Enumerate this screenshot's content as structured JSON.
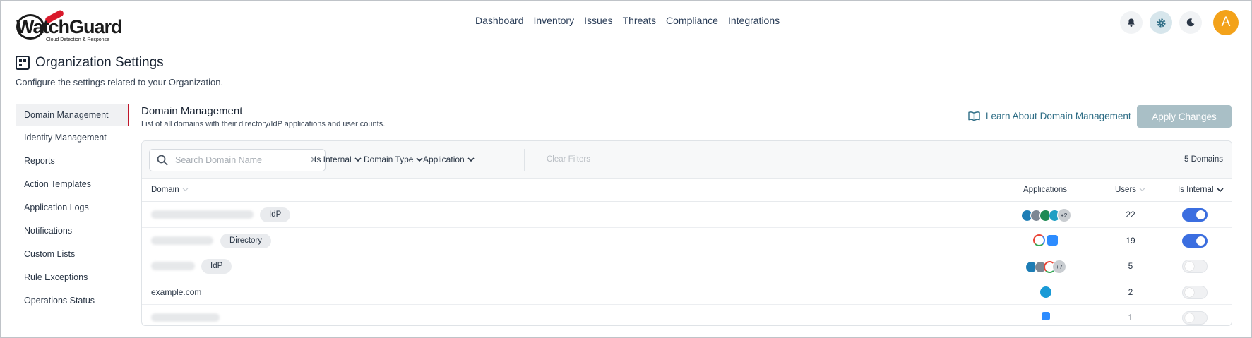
{
  "brand": {
    "name": "WatchGuard",
    "tagline": "Cloud Detection & Response",
    "accent": "#d9192b"
  },
  "nav": {
    "items": [
      "Dashboard",
      "Inventory",
      "Issues",
      "Threats",
      "Compliance",
      "Integrations"
    ]
  },
  "header": {
    "avatar_letter": "A",
    "icons": [
      "bell-icon",
      "gear-icon",
      "moon-icon"
    ]
  },
  "page": {
    "title": "Organization Settings",
    "subtitle": "Configure the settings related to your Organization."
  },
  "sidebar": {
    "items": [
      {
        "label": "Domain Management",
        "active": true
      },
      {
        "label": "Identity Management"
      },
      {
        "label": "Reports"
      },
      {
        "label": "Action Templates"
      },
      {
        "label": "Application Logs"
      },
      {
        "label": "Notifications"
      },
      {
        "label": "Custom Lists"
      },
      {
        "label": "Rule Exceptions"
      },
      {
        "label": "Operations Status"
      }
    ]
  },
  "main": {
    "title": "Domain Management",
    "description": "List of all domains with their directory/IdP applications and user counts.",
    "learn_link": "Learn About Domain Management",
    "apply_button": "Apply Changes"
  },
  "filters": {
    "search_placeholder": "Search Domain Name",
    "dropdowns": [
      "Is Internal",
      "Domain Type",
      "Application"
    ],
    "clear": "Clear Filters",
    "count": "5 Domains"
  },
  "table": {
    "headers": {
      "domain": "Domain",
      "applications": "Applications",
      "users": "Users",
      "internal": "Is Internal"
    },
    "rows": [
      {
        "domain": "",
        "tag": "IdP",
        "more": "+2",
        "users": "22",
        "internal": true
      },
      {
        "domain": "",
        "tag": "Directory",
        "more": "",
        "users": "19",
        "internal": true
      },
      {
        "domain": "",
        "tag": "IdP",
        "more": "+7",
        "users": "5",
        "internal": false
      },
      {
        "domain": "example.com",
        "tag": "",
        "more": "",
        "users": "2",
        "internal": false
      },
      {
        "domain": "",
        "tag": "",
        "more": "",
        "users": "1",
        "internal": false
      }
    ]
  },
  "colors": {
    "toggle_on": "#3b6ee0",
    "link": "#2f6e86",
    "apply_disabled": "#a9bfc6",
    "avatar": "#f3a21a"
  }
}
